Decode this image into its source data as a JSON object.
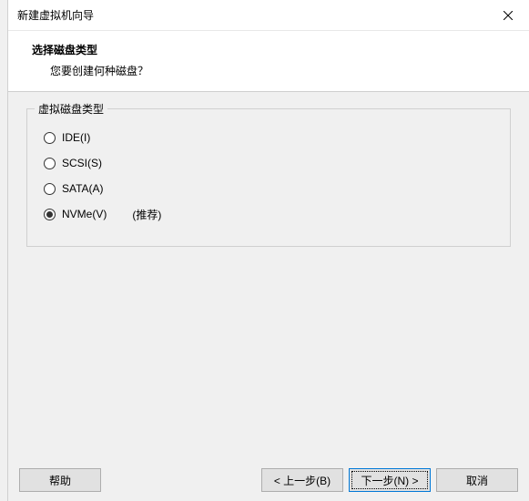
{
  "titlebar": {
    "title": "新建虚拟机向导"
  },
  "header": {
    "title": "选择磁盘类型",
    "subtitle": "您要创建何种磁盘？"
  },
  "group": {
    "label": "虚拟磁盘类型",
    "options": [
      {
        "label": "IDE(I)",
        "checked": false,
        "note": ""
      },
      {
        "label": "SCSI(S)",
        "checked": false,
        "note": ""
      },
      {
        "label": "SATA(A)",
        "checked": false,
        "note": ""
      },
      {
        "label": "NVMe(V)",
        "checked": true,
        "note": "(推荐)"
      }
    ]
  },
  "footer": {
    "help": "帮助",
    "back": "< 上一步(B)",
    "next": "下一步(N) >",
    "cancel": "取消"
  }
}
